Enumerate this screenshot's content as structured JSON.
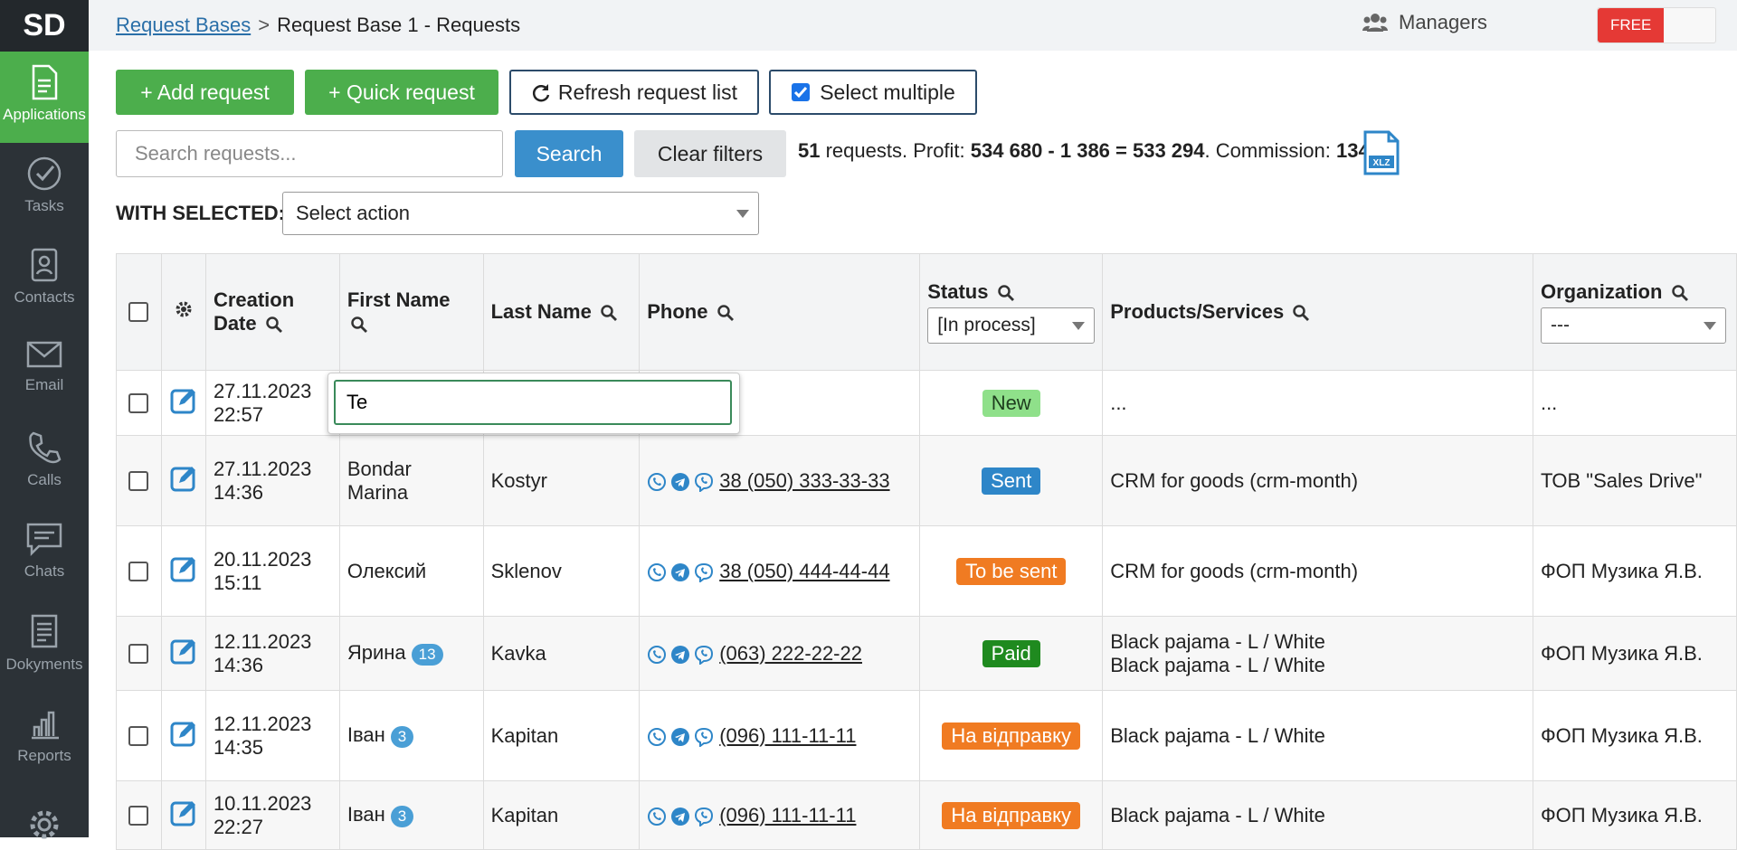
{
  "sidebar": {
    "logo": "SD",
    "items": [
      {
        "label": "Applications",
        "icon": "document-icon"
      },
      {
        "label": "Tasks",
        "icon": "check-circle-icon"
      },
      {
        "label": "Contacts",
        "icon": "contacts-icon"
      },
      {
        "label": "Email",
        "icon": "envelope-icon"
      },
      {
        "label": "Calls",
        "icon": "phone-icon"
      },
      {
        "label": "Chats",
        "icon": "chat-icon"
      },
      {
        "label": "Dokyments",
        "icon": "documents-icon"
      },
      {
        "label": "Reports",
        "icon": "bar-chart-icon"
      }
    ]
  },
  "topbar": {
    "breadcrumb_link": "Request Bases",
    "breadcrumb_sep": ">",
    "breadcrumb_current": "Request Base 1 - Requests",
    "managers_label": "Managers",
    "free_badge": "FREE"
  },
  "toolbar": {
    "add_request": "+ Add request",
    "quick_request": "+ Quick request",
    "refresh": "Refresh request list",
    "select_multiple": "Select multiple",
    "search_placeholder": "Search requests...",
    "search_button": "Search",
    "clear_filters": "Clear filters",
    "summary": {
      "count": "51",
      "t1": " requests. Profit: ",
      "profit": "534 680 - 1 386 = 533 294",
      "t2": ". Commission: ",
      "commission": "134.",
      "xlz": "XLZ"
    },
    "with_selected": "WITH SELECTED:",
    "select_action": "Select action"
  },
  "table": {
    "headers": {
      "creation_date": "Creation Date",
      "first_name": "First Name",
      "last_name": "Last Name",
      "phone": "Phone",
      "status": "Status",
      "status_filter": "[In process]",
      "products": "Products/Services",
      "organization": "Organization",
      "organization_filter": "---"
    },
    "rows": [
      {
        "date": "27.11.2023",
        "time": "22:57",
        "first": "",
        "count": "",
        "last": "",
        "phone": "",
        "status": "New",
        "products": "...",
        "products2": "",
        "org": "..."
      },
      {
        "date": "27.11.2023",
        "time": "14:36",
        "first": "Bondar Marina",
        "count": "",
        "last": "Kostyr",
        "phone": "38 (050) 333-33-33",
        "status": "Sent",
        "products": "CRM for goods (crm-month)",
        "products2": "",
        "org": "ТОВ \"Sales Drive\""
      },
      {
        "date": "20.11.2023",
        "time": "15:11",
        "first": "Олексий",
        "count": "",
        "last": "Sklenov",
        "phone": "38 (050) 444-44-44",
        "status": "To be sent",
        "products": "CRM for goods (crm-month)",
        "products2": "",
        "org": "ФОП Музика Я.В."
      },
      {
        "date": "12.11.2023",
        "time": "14:36",
        "first": "Ярина",
        "count": "13",
        "last": "Kavka",
        "phone": "(063) 222-22-22",
        "status": "Paid",
        "products": "Black pajama - L / White",
        "products2": "Black pajama - L / White",
        "org": "ФОП Музика Я.В."
      },
      {
        "date": "12.11.2023",
        "time": "14:35",
        "first": "Іван",
        "count": "3",
        "last": "Kapitan",
        "phone": "(096) 111-11-11",
        "status": "На відправку",
        "products": "Black pajama - L / White",
        "products2": "",
        "org": "ФОП Музика Я.В."
      },
      {
        "date": "10.11.2023",
        "time": "22:27",
        "first": "Іван",
        "count": "3",
        "last": "Kapitan",
        "phone": "(096) 111-11-11",
        "status": "На відправку",
        "products": "Black pajama - L / White",
        "products2": "",
        "org": "ФОП Музика Я.В."
      }
    ]
  },
  "popover": {
    "value": "Te"
  },
  "colors": {
    "accent_green": "#4cae4c",
    "accent_blue": "#3a8fcc",
    "sidebar_bg": "#2c3237"
  }
}
